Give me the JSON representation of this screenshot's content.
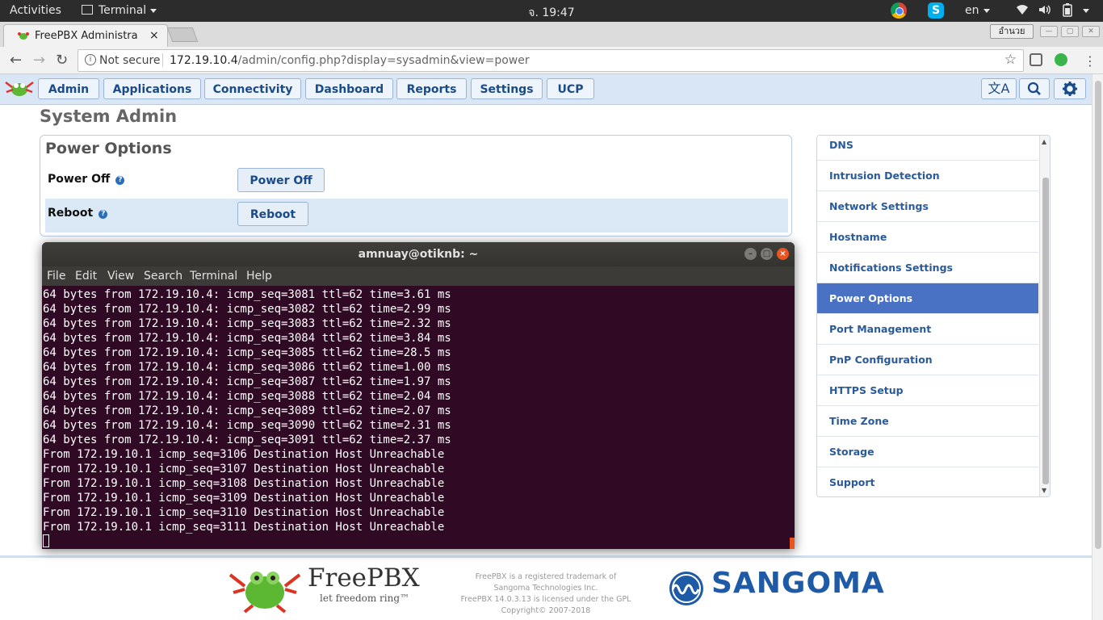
{
  "topbar": {
    "activities": "Activities",
    "app_menu": "Terminal",
    "clock": "จ. 19:47",
    "language": "en",
    "colors": {
      "background": "#2c2c2c"
    }
  },
  "browser": {
    "tab_title": "FreePBX Administra",
    "tab_close": "×",
    "profile_name": "อำนวย",
    "security_label": "Not secure",
    "url_host": "172.19.10.4",
    "url_path": "/admin/config.php?display=sysadmin&view=power"
  },
  "nav": {
    "items": [
      "Admin",
      "Applications",
      "Connectivity",
      "Dashboard",
      "Reports",
      "Settings",
      "UCP"
    ],
    "icons": [
      "translate-icon",
      "search-icon",
      "gear-icon"
    ]
  },
  "page": {
    "title": "System Admin",
    "section_title": "Power Options",
    "rows": [
      {
        "label": "Power Off",
        "button": "Power Off"
      },
      {
        "label": "Reboot",
        "button": "Reboot"
      }
    ]
  },
  "sidebar": {
    "active": "Power Options",
    "items": [
      "DNS",
      "Intrusion Detection",
      "Network Settings",
      "Hostname",
      "Notifications Settings",
      "Power Options",
      "Port Management",
      "PnP Configuration",
      "HTTPS Setup",
      "Time Zone",
      "Storage",
      "Support"
    ]
  },
  "terminal": {
    "title": "amnuay@otiknb: ~",
    "menu": [
      "File",
      "Edit",
      "View",
      "Search",
      "Terminal",
      "Help"
    ],
    "lines": [
      "64 bytes from 172.19.10.4: icmp_seq=3081 ttl=62 time=3.61 ms",
      "64 bytes from 172.19.10.4: icmp_seq=3082 ttl=62 time=2.99 ms",
      "64 bytes from 172.19.10.4: icmp_seq=3083 ttl=62 time=2.32 ms",
      "64 bytes from 172.19.10.4: icmp_seq=3084 ttl=62 time=3.84 ms",
      "64 bytes from 172.19.10.4: icmp_seq=3085 ttl=62 time=28.5 ms",
      "64 bytes from 172.19.10.4: icmp_seq=3086 ttl=62 time=1.00 ms",
      "64 bytes from 172.19.10.4: icmp_seq=3087 ttl=62 time=1.97 ms",
      "64 bytes from 172.19.10.4: icmp_seq=3088 ttl=62 time=2.04 ms",
      "64 bytes from 172.19.10.4: icmp_seq=3089 ttl=62 time=2.07 ms",
      "64 bytes from 172.19.10.4: icmp_seq=3090 ttl=62 time=2.31 ms",
      "64 bytes from 172.19.10.4: icmp_seq=3091 ttl=62 time=2.37 ms",
      "From 172.19.10.1 icmp_seq=3106 Destination Host Unreachable",
      "From 172.19.10.1 icmp_seq=3107 Destination Host Unreachable",
      "From 172.19.10.1 icmp_seq=3108 Destination Host Unreachable",
      "From 172.19.10.1 icmp_seq=3109 Destination Host Unreachable",
      "From 172.19.10.1 icmp_seq=3110 Destination Host Unreachable",
      "From 172.19.10.1 icmp_seq=3111 Destination Host Unreachable"
    ],
    "colors": {
      "background": "#300a24",
      "close": "#e95420"
    }
  },
  "footer": {
    "brand": "FreePBX",
    "tagline": "let freedom ring™",
    "notice": [
      "FreePBX is a registered trademark of",
      "Sangoma Technologies Inc.",
      "FreePBX 14.0.3.13 is licensed under the GPL",
      "Copyright© 2007-2018"
    ],
    "sponsor": "SANGOMA"
  }
}
